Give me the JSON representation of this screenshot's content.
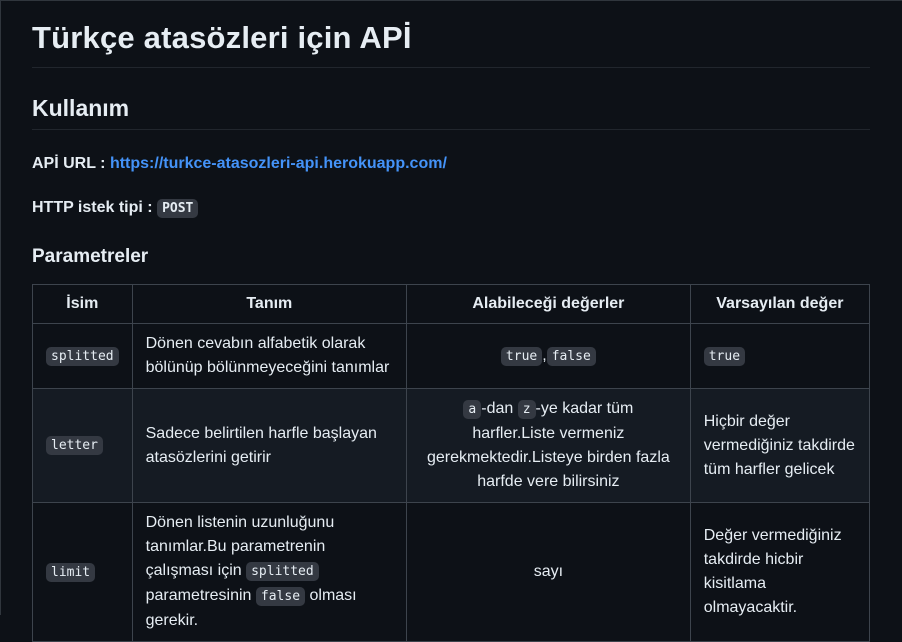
{
  "page": {
    "title": "Türkçe atasözleri için APİ",
    "usage_heading": "Kullanım",
    "api_url_label": "APİ URL : ",
    "api_url": "https://turkce-atasozleri-api.herokuapp.com/",
    "method_label": "HTTP istek tipi : ",
    "method": "POST",
    "params_heading": "Parametreler"
  },
  "table": {
    "headers": [
      "İsim",
      "Tanım",
      "Alabileceği değerler",
      "Varsayılan değer"
    ],
    "rows": [
      {
        "name": "splitted",
        "description": "Dönen cevabın alfabetik olarak bölünüp bölünmeyeceğini tanımlar",
        "values_code_1": "true",
        "values_sep": ",",
        "values_code_2": "false",
        "default_code": "true"
      },
      {
        "name": "letter",
        "description": "Sadece belirtilen harfle başlayan atasözlerini getirir",
        "values_code_a": "a",
        "values_text_1": "-dan ",
        "values_code_z": "z",
        "values_text_2": "-ye kadar tüm harfler.Liste vermeniz gerekmektedir.Listeye birden fazla harfde vere bilirsiniz",
        "default": "Hiçbir değer vermediğiniz takdirde tüm harfler gelicek"
      },
      {
        "name": "limit",
        "description_1": "Dönen listenin uzunluğunu tanımlar.Bu parametrenin çalışması için ",
        "description_code_1": "splitted",
        "description_2": " parametresinin ",
        "description_code_2": "false",
        "description_3": " olması gerekir.",
        "values": "sayı",
        "default": "Değer vermediğiniz takdirde hicbir kisitlama olmayacaktir."
      }
    ]
  }
}
